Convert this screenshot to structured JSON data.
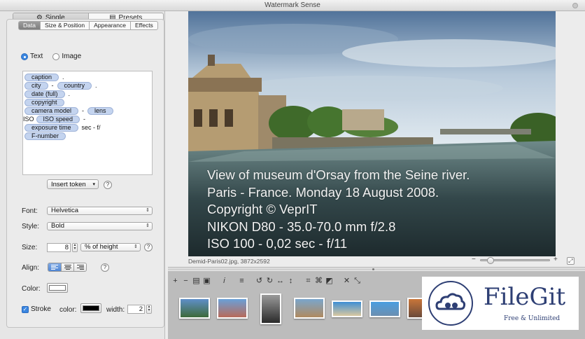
{
  "window": {
    "title": "Watermark Sense"
  },
  "mode_tabs": [
    {
      "label": "Single",
      "icon": "gear-icon",
      "active": true
    },
    {
      "label": "Presets",
      "icon": "list-icon",
      "active": false
    }
  ],
  "sub_tabs": [
    {
      "label": "Data",
      "active": true
    },
    {
      "label": "Size & Position",
      "active": false
    },
    {
      "label": "Appearance",
      "active": false
    },
    {
      "label": "Effects",
      "active": false
    }
  ],
  "source": {
    "text_label": "Text",
    "image_label": "Image",
    "selected": "Text"
  },
  "tokens": {
    "line1": {
      "t1": "caption",
      "s1": "."
    },
    "line2": {
      "t1": "city",
      "s1": "-",
      "t2": "country",
      "s2": "."
    },
    "line3": {
      "t1": "date (full)",
      "s1": "."
    },
    "line4": {
      "t1": "copyright"
    },
    "line5": {
      "t1": "camera model",
      "s1": "-",
      "t2": "lens"
    },
    "line6": {
      "s0": "ISO",
      "t1": "ISO speed",
      "s1": "-"
    },
    "line7": {
      "t1": "exposure time",
      "s1": "sec - f/"
    },
    "line8": {
      "t1": "F-number"
    }
  },
  "insert_token": {
    "label": "Insert token"
  },
  "font": {
    "label": "Font:",
    "value": "Helvetica"
  },
  "style": {
    "label": "Style:",
    "value": "Bold"
  },
  "size": {
    "label": "Size:",
    "value": "8",
    "unit": "% of height"
  },
  "align": {
    "label": "Align:",
    "selected": "left"
  },
  "color": {
    "label": "Color:",
    "value": "#ffffff"
  },
  "stroke": {
    "label": "Stroke",
    "checked": true,
    "color_label": "color:",
    "color_value": "#000000",
    "width_label": "width:",
    "width_value": "2"
  },
  "help_glyph": "?",
  "preview": {
    "watermark_lines": [
      "View of museum d'Orsay from the Seine river.",
      "Paris - France.  Monday 18 August 2008.",
      "Copyright © VeprIT",
      "NIKON D80 - 35.0-70.0 mm f/2.8",
      "ISO 100 - 0,02 sec - f/11"
    ]
  },
  "info": {
    "filename": "Demid-Paris02.jpg,  3872x2592",
    "zoom_level": 0.1,
    "zoom_out": "−",
    "zoom_in": "+"
  },
  "toolbar": {
    "icons": [
      {
        "name": "add-icon",
        "glyph": "+"
      },
      {
        "name": "remove-icon",
        "glyph": "−"
      },
      {
        "name": "save-icon",
        "glyph": "▤"
      },
      {
        "name": "open-icon",
        "glyph": "▣"
      },
      {
        "name": "info-icon",
        "glyph": "𝑖"
      },
      {
        "name": "menu-icon",
        "glyph": "≡"
      },
      {
        "name": "rotate-left-icon",
        "glyph": "↺"
      },
      {
        "name": "rotate-right-icon",
        "glyph": "↻"
      },
      {
        "name": "flip-horizontal-icon",
        "glyph": "↔"
      },
      {
        "name": "flip-vertical-icon",
        "glyph": "↕"
      },
      {
        "name": "crop-icon",
        "glyph": "⌗"
      },
      {
        "name": "fit-icon",
        "glyph": "⌘"
      },
      {
        "name": "resize-icon",
        "glyph": "◩"
      },
      {
        "name": "close-icon",
        "glyph": "✕"
      },
      {
        "name": "collapse-icon",
        "glyph": "⤡"
      }
    ]
  },
  "thumbnails": [
    {
      "colors": [
        "#5f8fc9",
        "#3d6a3a"
      ]
    },
    {
      "colors": [
        "#6aa0d8",
        "#b96a5a"
      ]
    },
    {
      "colors": [
        "#9a9a9a",
        "#2a2a2a"
      ]
    },
    {
      "colors": [
        "#7aa6cc",
        "#b08a60"
      ]
    },
    {
      "colors": [
        "#3f8fd4",
        "#d9c8a0"
      ]
    },
    {
      "colors": [
        "#4a9ee0",
        "#6c8fb0"
      ]
    },
    {
      "colors": [
        "#c9763a",
        "#6a4a3a"
      ]
    }
  ],
  "logo": {
    "name": "FileGit",
    "tagline": "Free & Unlimited"
  }
}
